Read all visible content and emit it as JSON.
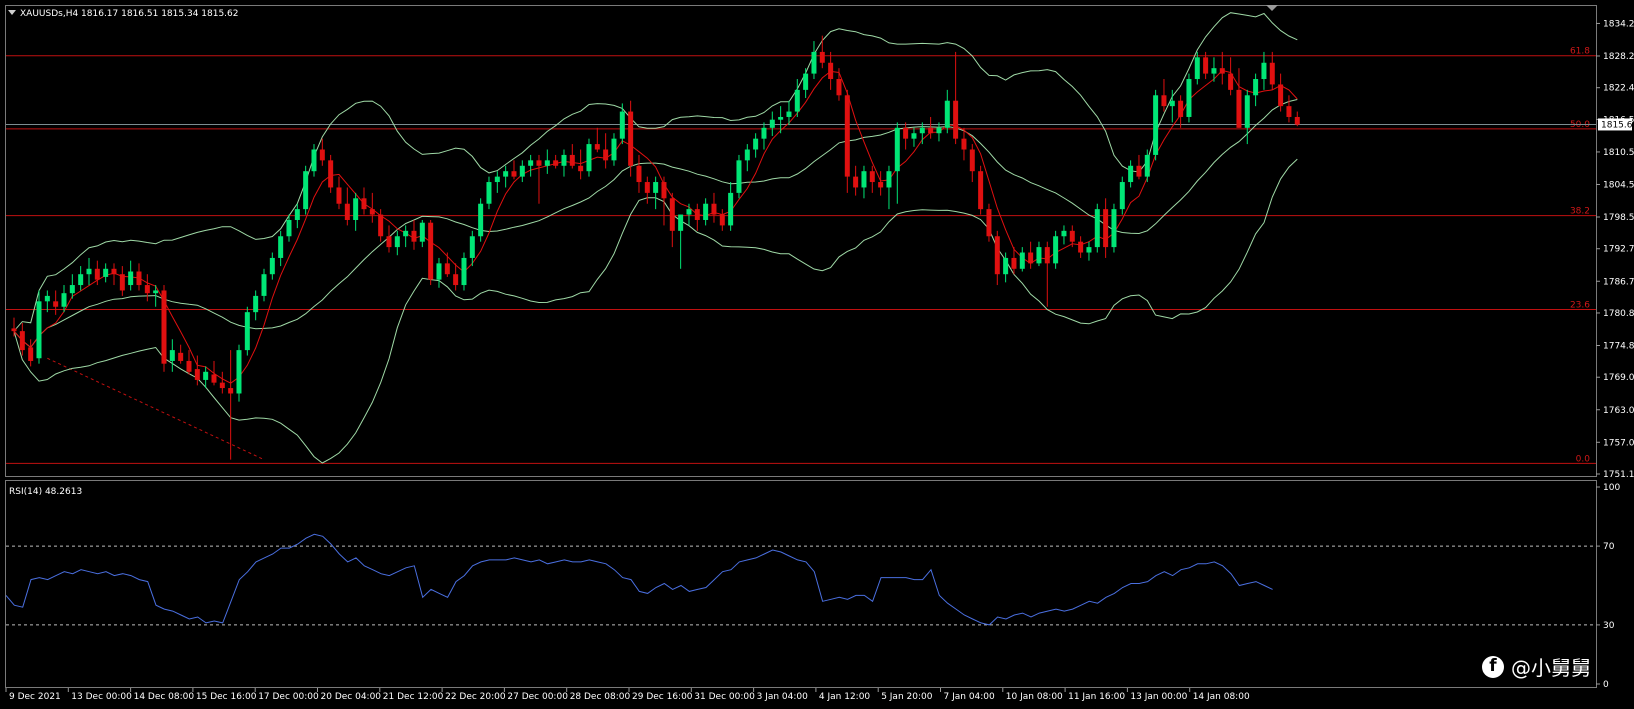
{
  "header": {
    "symbol_info": "XAUUSDs,H4  1816.17 1816.51 1815.34 1815.62",
    "dropdown_icon": "triangle-down-icon"
  },
  "indicator": {
    "label": "RSI(14) 48.2613",
    "levels": [
      70,
      30
    ],
    "axis_labels": [
      "100",
      "70",
      "30",
      "0"
    ]
  },
  "watermark": {
    "icon": "facebook-icon",
    "text": "@小舅舅"
  },
  "colors": {
    "background": "#000000",
    "bull": "#00e676",
    "bear": "#e01010",
    "bollinger": "#9fd9a6",
    "ma_fast": "#e01010",
    "ma_slow": "#9fd9a6",
    "fibo": "#c01010",
    "rsi": "#4a6fe0"
  },
  "chart_data": {
    "type": "candlestick",
    "symbol": "XAUUSDs",
    "timeframe": "H4",
    "ylim": [
      1751.15,
      1837.1
    ],
    "price_ticks": [
      "1834.25",
      "1828.25",
      "1822.40",
      "1816.55",
      "1810.55",
      "1804.55",
      "1798.55",
      "1792.70",
      "1786.70",
      "1780.85",
      "1774.85",
      "1769.00",
      "1763.00",
      "1757.00",
      "1751.15"
    ],
    "current_price": "1815.62",
    "x_ticks": [
      "9 Dec 2021",
      "13 Dec 00:00",
      "14 Dec 08:00",
      "15 Dec 16:00",
      "17 Dec 00:00",
      "20 Dec 04:00",
      "21 Dec 12:00",
      "22 Dec 20:00",
      "27 Dec 00:00",
      "28 Dec 08:00",
      "29 Dec 16:00",
      "31 Dec 00:00",
      "3 Jan 04:00",
      "4 Jan 12:00",
      "5 Jan 20:00",
      "7 Jan 04:00",
      "10 Jan 08:00",
      "11 Jan 16:00",
      "13 Jan 00:00",
      "14 Jan 08:00"
    ],
    "fibonacci": [
      {
        "label": "61.8",
        "price": 1828.3
      },
      {
        "label": "50.0",
        "price": 1814.8
      },
      {
        "label": "38.2",
        "price": 1798.8
      },
      {
        "label": "23.6",
        "price": 1781.5
      },
      {
        "label": "0.0",
        "price": 1753.1
      }
    ],
    "trendline": {
      "from_candle": 4,
      "from_price": 1772.5,
      "to_candle": 30,
      "to_price": 1753.8
    },
    "candles": [
      [
        1778,
        1780,
        1776.5,
        1777.5
      ],
      [
        1777.5,
        1779,
        1773,
        1774
      ],
      [
        1774.5,
        1776,
        1771,
        1772
      ],
      [
        1772.5,
        1785,
        1771.5,
        1783
      ],
      [
        1783,
        1785,
        1781,
        1784
      ],
      [
        1783,
        1785,
        1780.5,
        1782
      ],
      [
        1782,
        1786,
        1781,
        1784.5
      ],
      [
        1784.5,
        1788,
        1783.5,
        1786
      ],
      [
        1786,
        1789.5,
        1785,
        1788
      ],
      [
        1788,
        1791,
        1786,
        1789
      ],
      [
        1789,
        1790.5,
        1786,
        1787
      ],
      [
        1787.5,
        1790,
        1786.5,
        1789
      ],
      [
        1789,
        1790,
        1786,
        1788
      ],
      [
        1788,
        1789.5,
        1784,
        1785
      ],
      [
        1786,
        1790.5,
        1785,
        1788.5
      ],
      [
        1788.5,
        1790,
        1785,
        1786
      ],
      [
        1786,
        1788,
        1783,
        1784.5
      ],
      [
        1784.5,
        1786,
        1782,
        1785
      ],
      [
        1785,
        1786,
        1770,
        1771.5
      ],
      [
        1772,
        1776,
        1770,
        1774
      ],
      [
        1773.5,
        1775,
        1771.5,
        1772
      ],
      [
        1772,
        1774,
        1769.5,
        1770
      ],
      [
        1770.5,
        1773,
        1767.5,
        1768.5
      ],
      [
        1768.5,
        1771,
        1767,
        1770
      ],
      [
        1769.5,
        1772,
        1767.5,
        1768
      ],
      [
        1768,
        1770,
        1766,
        1767
      ],
      [
        1767,
        1774,
        1753.8,
        1766
      ],
      [
        1766,
        1775,
        1764.5,
        1774
      ],
      [
        1774,
        1782,
        1773,
        1781
      ],
      [
        1781,
        1785,
        1779.5,
        1784
      ],
      [
        1784,
        1789,
        1783,
        1788
      ],
      [
        1788,
        1792,
        1787,
        1791
      ],
      [
        1791,
        1796,
        1789.5,
        1795
      ],
      [
        1795,
        1799,
        1794,
        1798
      ],
      [
        1798,
        1801,
        1796.5,
        1800
      ],
      [
        1800,
        1808,
        1799,
        1807
      ],
      [
        1807,
        1812,
        1806,
        1811
      ],
      [
        1811,
        1813,
        1808,
        1809
      ],
      [
        1809,
        1810,
        1803,
        1804
      ],
      [
        1804,
        1806,
        1800,
        1801
      ],
      [
        1801,
        1804,
        1797,
        1798
      ],
      [
        1798,
        1803,
        1796,
        1802
      ],
      [
        1802,
        1804,
        1799,
        1800
      ],
      [
        1800,
        1803,
        1797.5,
        1799
      ],
      [
        1799,
        1800,
        1794,
        1795
      ],
      [
        1795,
        1797,
        1792,
        1793
      ],
      [
        1793,
        1796,
        1791.5,
        1795
      ],
      [
        1795,
        1797,
        1793,
        1796
      ],
      [
        1796,
        1798,
        1792.5,
        1794
      ],
      [
        1794,
        1798,
        1793,
        1797.5
      ],
      [
        1797.5,
        1798,
        1786,
        1787
      ],
      [
        1787,
        1791,
        1785.5,
        1790
      ],
      [
        1790,
        1792,
        1787.5,
        1788
      ],
      [
        1788,
        1790,
        1785,
        1786
      ],
      [
        1786,
        1792,
        1785,
        1791
      ],
      [
        1791,
        1796,
        1789.5,
        1795
      ],
      [
        1795,
        1802,
        1794,
        1801
      ],
      [
        1801,
        1806,
        1800,
        1805
      ],
      [
        1805,
        1807,
        1803,
        1806
      ],
      [
        1806,
        1808,
        1804,
        1807
      ],
      [
        1807,
        1809,
        1805.5,
        1806
      ],
      [
        1806,
        1809,
        1805,
        1808
      ],
      [
        1808,
        1810,
        1806,
        1809
      ],
      [
        1809,
        1810,
        1801,
        1808
      ],
      [
        1808,
        1811,
        1806.5,
        1809
      ],
      [
        1809,
        1810,
        1807.5,
        1808
      ],
      [
        1808,
        1811,
        1806,
        1810
      ],
      [
        1810,
        1812,
        1807.5,
        1808
      ],
      [
        1808,
        1811,
        1805.5,
        1807
      ],
      [
        1807,
        1813,
        1806,
        1812
      ],
      [
        1812,
        1815,
        1810.5,
        1811
      ],
      [
        1811,
        1814,
        1807.5,
        1809
      ],
      [
        1809,
        1814,
        1808,
        1813
      ],
      [
        1813,
        1819.5,
        1812,
        1818
      ],
      [
        1818,
        1820,
        1806,
        1808
      ],
      [
        1808,
        1810,
        1803,
        1805
      ],
      [
        1805,
        1806,
        1801,
        1803
      ],
      [
        1803,
        1806,
        1800,
        1805
      ],
      [
        1805,
        1806,
        1797,
        1802
      ],
      [
        1802,
        1803,
        1793,
        1796
      ],
      [
        1796,
        1799,
        1789,
        1799
      ],
      [
        1799,
        1801,
        1797,
        1800
      ],
      [
        1800,
        1801,
        1796,
        1798
      ],
      [
        1798,
        1802,
        1797,
        1801
      ],
      [
        1801,
        1803,
        1797.5,
        1799
      ],
      [
        1799,
        1800,
        1796,
        1797
      ],
      [
        1797,
        1805,
        1796,
        1803
      ],
      [
        1803,
        1810,
        1802,
        1809
      ],
      [
        1809,
        1812,
        1807,
        1811
      ],
      [
        1811,
        1814,
        1809.5,
        1813
      ],
      [
        1813,
        1816,
        1811,
        1815
      ],
      [
        1815,
        1818,
        1813.5,
        1816.5
      ],
      [
        1816.5,
        1819,
        1814,
        1817
      ],
      [
        1817,
        1820,
        1815.5,
        1818
      ],
      [
        1818,
        1824,
        1817,
        1822
      ],
      [
        1822,
        1826,
        1820.5,
        1825
      ],
      [
        1825,
        1831,
        1824,
        1829
      ],
      [
        1829,
        1832,
        1826,
        1827
      ],
      [
        1827,
        1829,
        1822,
        1824
      ],
      [
        1824,
        1826,
        1820,
        1821
      ],
      [
        1821,
        1822,
        1803,
        1806
      ],
      [
        1806,
        1808,
        1802.5,
        1804
      ],
      [
        1804,
        1808,
        1802,
        1807
      ],
      [
        1807,
        1808,
        1803,
        1805
      ],
      [
        1805,
        1807,
        1802.5,
        1804
      ],
      [
        1804,
        1808,
        1800,
        1807
      ],
      [
        1807,
        1816,
        1801,
        1815
      ],
      [
        1815,
        1816,
        1811,
        1813
      ],
      [
        1813,
        1815,
        1811.5,
        1814
      ],
      [
        1814,
        1816,
        1812,
        1815
      ],
      [
        1815,
        1817,
        1813,
        1814
      ],
      [
        1814,
        1816,
        1812.5,
        1815
      ],
      [
        1815,
        1822,
        1814,
        1820
      ],
      [
        1820,
        1829,
        1812,
        1813
      ],
      [
        1813,
        1815,
        1809,
        1811
      ],
      [
        1811,
        1812,
        1805,
        1807
      ],
      [
        1807,
        1808,
        1799,
        1800
      ],
      [
        1800,
        1801,
        1794,
        1795
      ],
      [
        1795,
        1796,
        1786,
        1788
      ],
      [
        1788,
        1792,
        1786.5,
        1791
      ],
      [
        1791,
        1793,
        1788,
        1789
      ],
      [
        1789,
        1793,
        1788.5,
        1792
      ],
      [
        1792,
        1794,
        1789,
        1790
      ],
      [
        1790,
        1794,
        1789.5,
        1793
      ],
      [
        1793,
        1794,
        1782,
        1790
      ],
      [
        1790,
        1796,
        1789,
        1795
      ],
      [
        1795,
        1797,
        1793.5,
        1796
      ],
      [
        1796,
        1797,
        1793,
        1794
      ],
      [
        1794,
        1795,
        1791,
        1792
      ],
      [
        1792,
        1794,
        1790.5,
        1793
      ],
      [
        1793,
        1801,
        1792,
        1800
      ],
      [
        1800,
        1802,
        1791,
        1793
      ],
      [
        1793,
        1801,
        1792,
        1800
      ],
      [
        1800,
        1806,
        1799,
        1805
      ],
      [
        1805,
        1809,
        1804,
        1808
      ],
      [
        1808,
        1810,
        1805.5,
        1806
      ],
      [
        1806,
        1811,
        1805,
        1810
      ],
      [
        1810,
        1822,
        1809,
        1821
      ],
      [
        1821,
        1824,
        1818,
        1819
      ],
      [
        1819,
        1822,
        1816,
        1820
      ],
      [
        1820,
        1821,
        1815,
        1817
      ],
      [
        1817,
        1825,
        1816,
        1824
      ],
      [
        1824,
        1829,
        1823,
        1828
      ],
      [
        1828,
        1829,
        1824,
        1825
      ],
      [
        1825,
        1828,
        1823.5,
        1826
      ],
      [
        1826,
        1829,
        1823,
        1825
      ],
      [
        1825,
        1828,
        1821,
        1822
      ],
      [
        1822,
        1826,
        1815,
        1815
      ],
      [
        1815,
        1822,
        1812,
        1821
      ],
      [
        1821,
        1825,
        1819,
        1824
      ],
      [
        1824,
        1829,
        1822,
        1827
      ],
      [
        1827,
        1829,
        1822,
        1823
      ],
      [
        1823,
        1825,
        1818,
        1819
      ],
      [
        1819,
        1821,
        1816,
        1817
      ],
      [
        1817,
        1818,
        1815.3,
        1815.6
      ]
    ],
    "rsi": [
      45,
      40,
      39,
      53,
      54,
      53,
      55,
      57,
      56,
      58,
      57,
      56,
      57,
      55,
      56,
      55,
      53,
      52,
      40,
      38,
      37,
      35,
      33,
      34,
      31,
      32,
      31,
      42,
      53,
      57,
      62,
      64,
      66,
      69,
      69,
      71,
      74,
      76,
      75,
      71,
      66,
      62,
      64,
      60,
      58,
      56,
      55,
      57,
      59,
      60,
      44,
      48,
      46,
      44,
      52,
      55,
      60,
      62,
      63,
      63,
      63,
      64,
      63,
      62,
      63,
      61,
      62,
      63,
      62,
      62,
      63,
      62,
      61,
      58,
      54,
      53,
      47,
      46,
      49,
      51,
      48,
      50,
      47,
      48,
      49,
      53,
      57,
      58,
      62,
      63,
      64,
      66,
      68,
      67,
      65,
      63,
      62,
      57,
      42,
      43,
      44,
      43,
      45,
      45,
      42,
      54,
      54,
      54,
      54,
      53,
      53,
      58,
      45,
      41,
      38,
      35,
      33,
      31,
      30,
      34,
      33,
      35,
      36,
      34,
      36,
      37,
      38,
      37,
      38,
      40,
      42,
      41,
      44,
      46,
      49,
      51,
      51,
      52,
      55,
      57,
      55,
      58,
      59,
      61,
      61,
      62,
      60,
      56,
      50,
      51,
      52,
      50,
      48
    ]
  }
}
